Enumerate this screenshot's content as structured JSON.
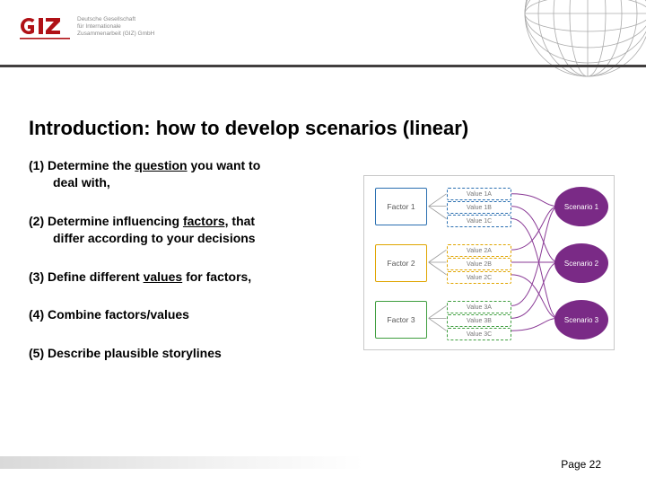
{
  "logo": {
    "brand": "giz",
    "tagline_l1": "Deutsche Gesellschaft",
    "tagline_l2": "für Internationale",
    "tagline_l3": "Zusammenarbeit (GIZ) GmbH"
  },
  "title": "Introduction: how to develop scenarios (linear)",
  "steps": [
    {
      "num": "(1)",
      "pre": "Determine the ",
      "key": "question",
      "post": " you want to",
      "line2": "deal with,"
    },
    {
      "num": "(2)",
      "pre": "Determine influencing ",
      "key": "factors,",
      "post": " that",
      "line2": "differ according to your decisions"
    },
    {
      "num": "(3)",
      "pre": "Define different ",
      "key": "values",
      "post": " for factors,",
      "line2": ""
    },
    {
      "num": "(4)",
      "pre": "Combine factors/values",
      "key": "",
      "post": "",
      "line2": ""
    },
    {
      "num": "(5)",
      "pre": "Describe plausible storylines",
      "key": "",
      "post": "",
      "line2": ""
    }
  ],
  "diagram": {
    "factors": [
      {
        "label": "Factor 1",
        "color": "#2a6fb1"
      },
      {
        "label": "Factor 2",
        "color": "#e0a500"
      },
      {
        "label": "Factor 3",
        "color": "#3f9e3f"
      }
    ],
    "values": [
      [
        {
          "label": "Value 1A"
        },
        {
          "label": "Value 1B"
        },
        {
          "label": "Value 1C"
        }
      ],
      [
        {
          "label": "Value 2A"
        },
        {
          "label": "Value 2B"
        },
        {
          "label": "Value 2C"
        }
      ],
      [
        {
          "label": "Value 3A"
        },
        {
          "label": "Value 3B"
        },
        {
          "label": "Value 3C"
        }
      ]
    ],
    "scenarios": [
      {
        "label": "Scenario 1"
      },
      {
        "label": "Scenario 2"
      },
      {
        "label": "Scenario 3"
      }
    ]
  },
  "footer": {
    "page_label": "Page 22"
  }
}
